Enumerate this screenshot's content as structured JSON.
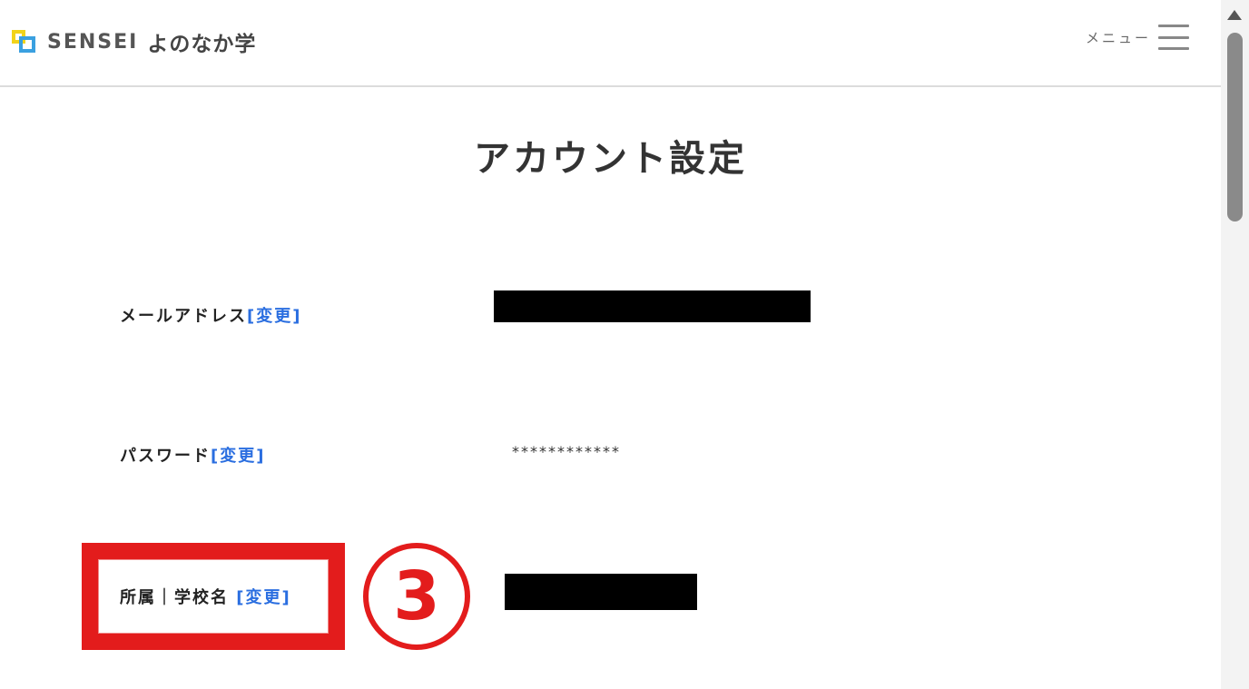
{
  "header": {
    "brand": "SENSEI",
    "brand_sub": "よのなか学",
    "menu_label": "メニュー"
  },
  "page": {
    "title": "アカウント設定"
  },
  "rows": {
    "email": {
      "label": "メールアドレス",
      "change": "[変更]"
    },
    "password": {
      "label": "パスワード",
      "change": "[変更]",
      "value": "************"
    },
    "school": {
      "label": "所属｜学校名",
      "change": "[変更]"
    }
  },
  "annotation": {
    "step": "3",
    "color": "#e31c1c"
  },
  "colors": {
    "link": "#2a6ee0",
    "logo_yellow": "#f2d31a",
    "logo_blue": "#3aa0e0",
    "redaction": "#000000"
  },
  "icons": {
    "logo": "sensei-logo-icon",
    "menu": "hamburger-menu-icon",
    "scroll_up": "scroll-up-arrow-icon"
  }
}
